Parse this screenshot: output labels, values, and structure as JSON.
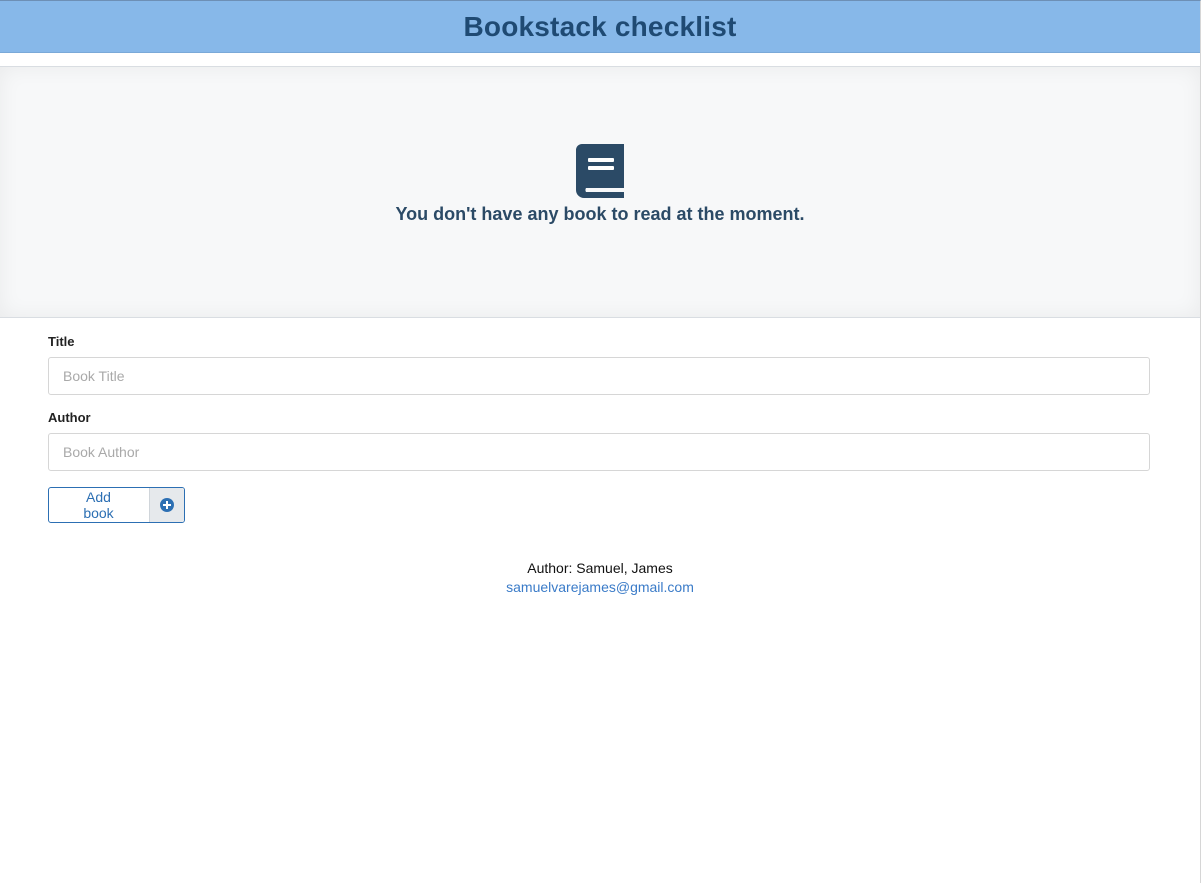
{
  "header": {
    "title": "Bookstack checklist"
  },
  "empty_state": {
    "icon": "book-icon",
    "message": "You don't have any book to read at the moment."
  },
  "form": {
    "title_label": "Title",
    "title_placeholder": "Book Title",
    "title_value": "",
    "author_label": "Author",
    "author_placeholder": "Book Author",
    "author_value": "",
    "add_button_label": "Add book",
    "add_button_icon": "plus-circle-icon"
  },
  "footer": {
    "author_text": "Author: Samuel, James",
    "email": "samuelvarejames@gmail.com"
  },
  "colors": {
    "header_bg": "#87b8e9",
    "header_text": "#1f4a73",
    "accent": "#2c6fb3",
    "icon": "#2b4a66",
    "link": "#3a7bc8"
  }
}
